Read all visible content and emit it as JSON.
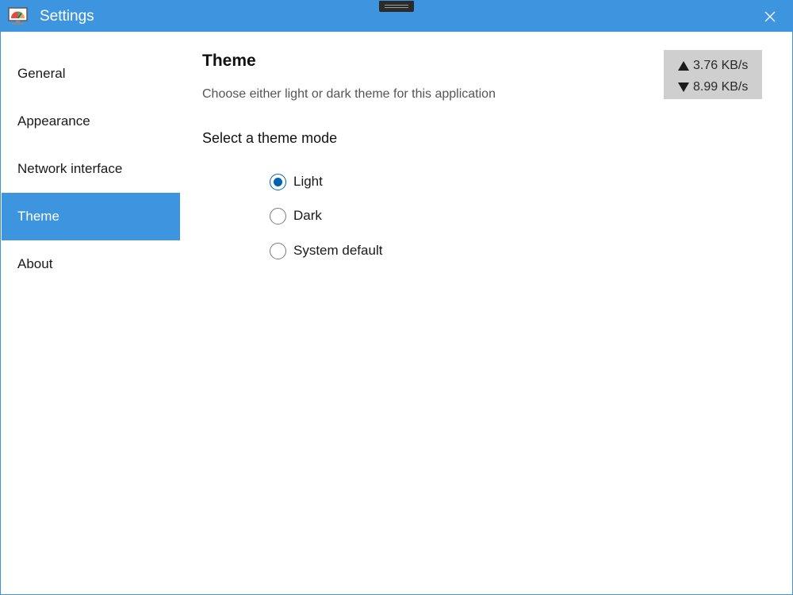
{
  "window": {
    "title": "Settings",
    "accent_color": "#3c95de",
    "app_icon": "network-monitor-icon",
    "close_icon": "close-icon"
  },
  "sidebar": {
    "items": [
      {
        "label": "General",
        "active": false
      },
      {
        "label": "Appearance",
        "active": false
      },
      {
        "label": "Network interface",
        "active": false
      },
      {
        "label": "Theme",
        "active": true
      },
      {
        "label": "About",
        "active": false
      }
    ]
  },
  "page": {
    "title": "Theme",
    "description": "Choose either light or dark theme for this application",
    "section_label": "Select a theme mode",
    "options": [
      {
        "label": "Light",
        "checked": true
      },
      {
        "label": "Dark",
        "checked": false
      },
      {
        "label": "System default",
        "checked": false
      }
    ]
  },
  "speed": {
    "upload": "3.76 KB/s",
    "download": "8.99 KB/s",
    "upload_icon": "up-arrow-icon",
    "download_icon": "down-arrow-icon"
  }
}
